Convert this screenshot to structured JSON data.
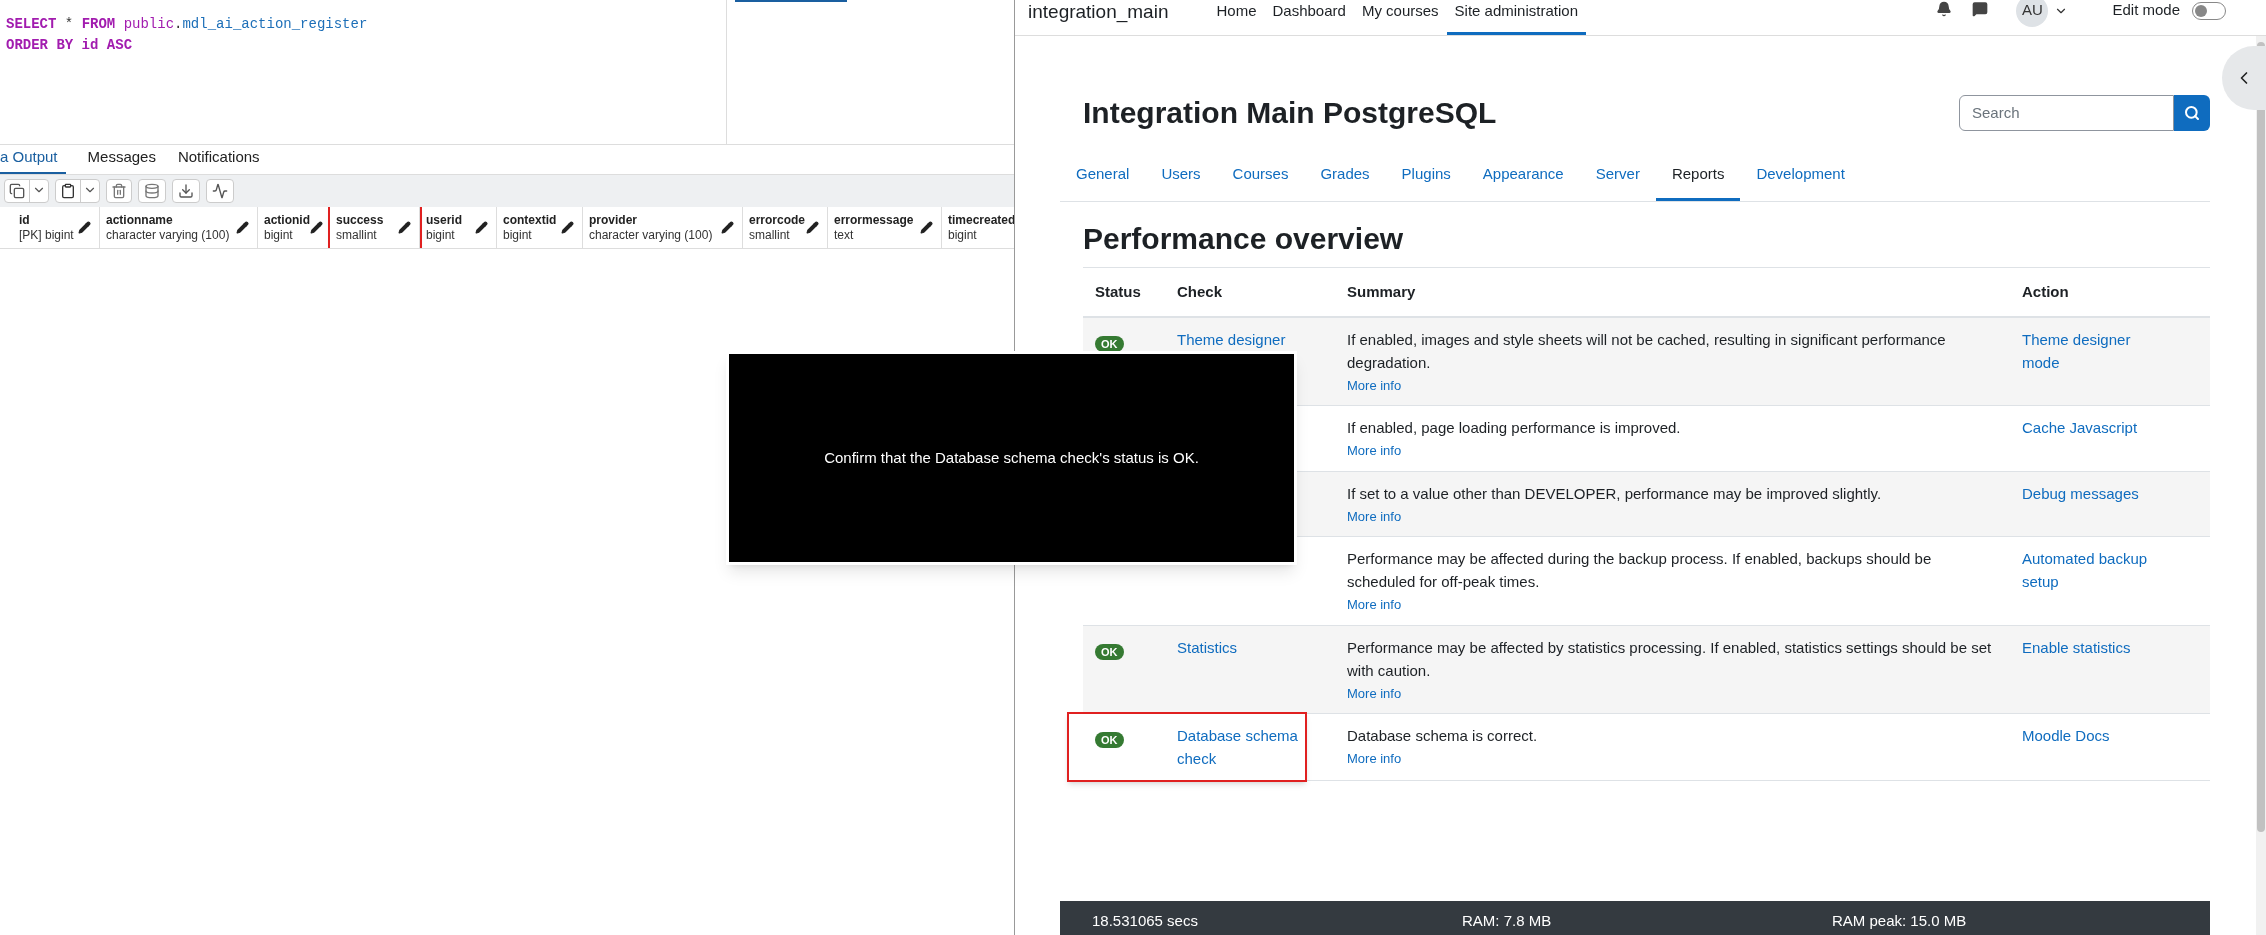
{
  "query_tool": {
    "sql_lines": [
      [
        {
          "kind": "keyword",
          "text": "SELECT"
        },
        {
          "kind": "plain",
          "text": " *"
        },
        {
          "kind": "keyword",
          "text": " FROM"
        },
        {
          "kind": "schema",
          "text": " public"
        },
        {
          "kind": "plain",
          "text": "."
        },
        {
          "kind": "ident",
          "text": "mdl_ai_action_register"
        }
      ],
      [
        {
          "kind": "keyword",
          "text": "ORDER BY"
        },
        {
          "kind": "keyword",
          "text": " id"
        },
        {
          "kind": "keyword",
          "text": " ASC"
        }
      ]
    ],
    "output_tabs": [
      {
        "label": "a Output",
        "selected": true
      },
      {
        "label": "Messages",
        "selected": false
      },
      {
        "label": "Notifications",
        "selected": false
      }
    ],
    "columns": [
      {
        "name": "id",
        "type": "[PK] bigint",
        "highlighted": false
      },
      {
        "name": "actionname",
        "type": "character varying (100)",
        "highlighted": false
      },
      {
        "name": "actionid",
        "type": "bigint",
        "highlighted": false
      },
      {
        "name": "success",
        "type": "smallint",
        "highlighted": true
      },
      {
        "name": "userid",
        "type": "bigint",
        "highlighted": false
      },
      {
        "name": "contextid",
        "type": "bigint",
        "highlighted": false
      },
      {
        "name": "provider",
        "type": "character varying (100)",
        "highlighted": false
      },
      {
        "name": "errorcode",
        "type": "smallint",
        "highlighted": false
      },
      {
        "name": "errormessage",
        "type": "text",
        "highlighted": false
      },
      {
        "name": "timecreated",
        "type": "bigint",
        "highlighted": false
      }
    ]
  },
  "site": {
    "brand": "integration_main",
    "nav": [
      {
        "label": "Home",
        "selected": false
      },
      {
        "label": "Dashboard",
        "selected": false
      },
      {
        "label": "My courses",
        "selected": false
      },
      {
        "label": "Site administration",
        "selected": true
      }
    ],
    "avatar": "AU",
    "edit_mode": {
      "label": "Edit mode",
      "on": false
    },
    "title": "Integration Main PostgreSQL",
    "search": {
      "placeholder": "Search"
    },
    "tabs": [
      {
        "label": "General",
        "selected": false
      },
      {
        "label": "Users",
        "selected": false
      },
      {
        "label": "Courses",
        "selected": false
      },
      {
        "label": "Grades",
        "selected": false
      },
      {
        "label": "Plugins",
        "selected": false
      },
      {
        "label": "Appearance",
        "selected": false
      },
      {
        "label": "Server",
        "selected": false
      },
      {
        "label": "Reports",
        "selected": true
      },
      {
        "label": "Development",
        "selected": false
      }
    ],
    "heading": "Performance overview",
    "table": {
      "columns": [
        "Status",
        "Check",
        "Summary",
        "Action"
      ],
      "rows": [
        {
          "status": "OK",
          "check": "Theme designer",
          "summary": "If enabled, images and style sheets will not be cached, resulting in significant performance degradation.",
          "more": "More info",
          "action": "Theme designer mode",
          "highlighted": false
        },
        {
          "summary": "If enabled, page loading performance is improved.",
          "more": "More info",
          "action": "Cache Javascript",
          "highlighted": false
        },
        {
          "summary": "If set to a value other than DEVELOPER, performance may be improved slightly.",
          "more": "More info",
          "action": "Debug messages",
          "highlighted": false
        },
        {
          "summary": "Performance may be affected during the backup process. If enabled, backups should be scheduled for off-peak times.",
          "more": "More info",
          "action": "Automated backup setup",
          "highlighted": false
        },
        {
          "status": "OK",
          "check": "Statistics",
          "summary": "Performance may be affected by statistics processing. If enabled, statistics settings should be set with caution.",
          "more": "More info",
          "action": "Enable statistics",
          "highlighted": false
        },
        {
          "status": "OK",
          "check": "Database schema check",
          "summary": "Database schema is correct.",
          "more": "More info",
          "action": "Moodle Docs",
          "highlighted": true
        }
      ]
    },
    "footer": [
      "18.531065 secs",
      "RAM: 7.8 MB",
      "RAM peak: 15.0 MB"
    ]
  },
  "overlay": {
    "message": "Confirm that the Database schema check's status is OK."
  }
}
